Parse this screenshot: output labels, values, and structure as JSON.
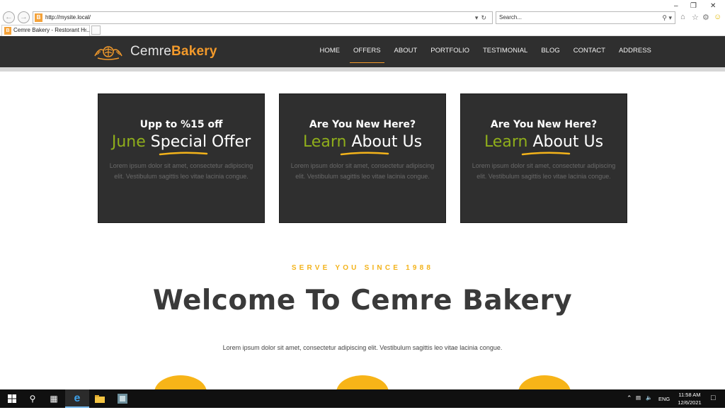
{
  "browser": {
    "url": "http://mysite.local/",
    "search_placeholder": "Search...",
    "tab_title": "Cemre Bakery - Restorant H...",
    "favicon_letter": "B"
  },
  "site": {
    "logo_light": "Cemre",
    "logo_bold": "Bakery",
    "menu": [
      {
        "label": "HOME"
      },
      {
        "label": "OFFERS"
      },
      {
        "label": "ABOUT"
      },
      {
        "label": "PORTFOLIO"
      },
      {
        "label": "TESTIMONIAL"
      },
      {
        "label": "BLOG"
      },
      {
        "label": "CONTACT"
      },
      {
        "label": "ADDRESS"
      }
    ],
    "active_menu": "OFFERS",
    "accent_color": "#f39a2b",
    "green_color": "#8fae1b",
    "gold_color": "#f3b31b"
  },
  "cards": [
    {
      "pre": "Upp to %15 off",
      "green": "June",
      "white": "Special Offer",
      "desc": "Lorem ipsum dolor sit amet, consectetur adipiscing elit. Vestibulum sagittis leo vitae lacinia congue."
    },
    {
      "pre": "Are You New Here?",
      "green": "Learn",
      "white": "About Us",
      "desc": "Lorem ipsum dolor sit amet, consectetur adipiscing elit. Vestibulum sagittis leo vitae lacinia congue."
    },
    {
      "pre": "Are You New Here?",
      "green": "Learn",
      "white": "About Us",
      "desc": "Lorem ipsum dolor sit amet, consectetur adipiscing elit. Vestibulum sagittis leo vitae lacinia congue."
    }
  ],
  "intro": {
    "kicker": "SERVE YOU SINCE 1988",
    "heading": "Welcome To Cemre Bakery",
    "lead": "Lorem ipsum dolor sit amet, consectetur adipiscing elit. Vestibulum sagittis leo vitae lacinia congue."
  },
  "taskbar": {
    "lang": "ENG",
    "time": "11:58 AM",
    "date": "12/6/2021"
  }
}
